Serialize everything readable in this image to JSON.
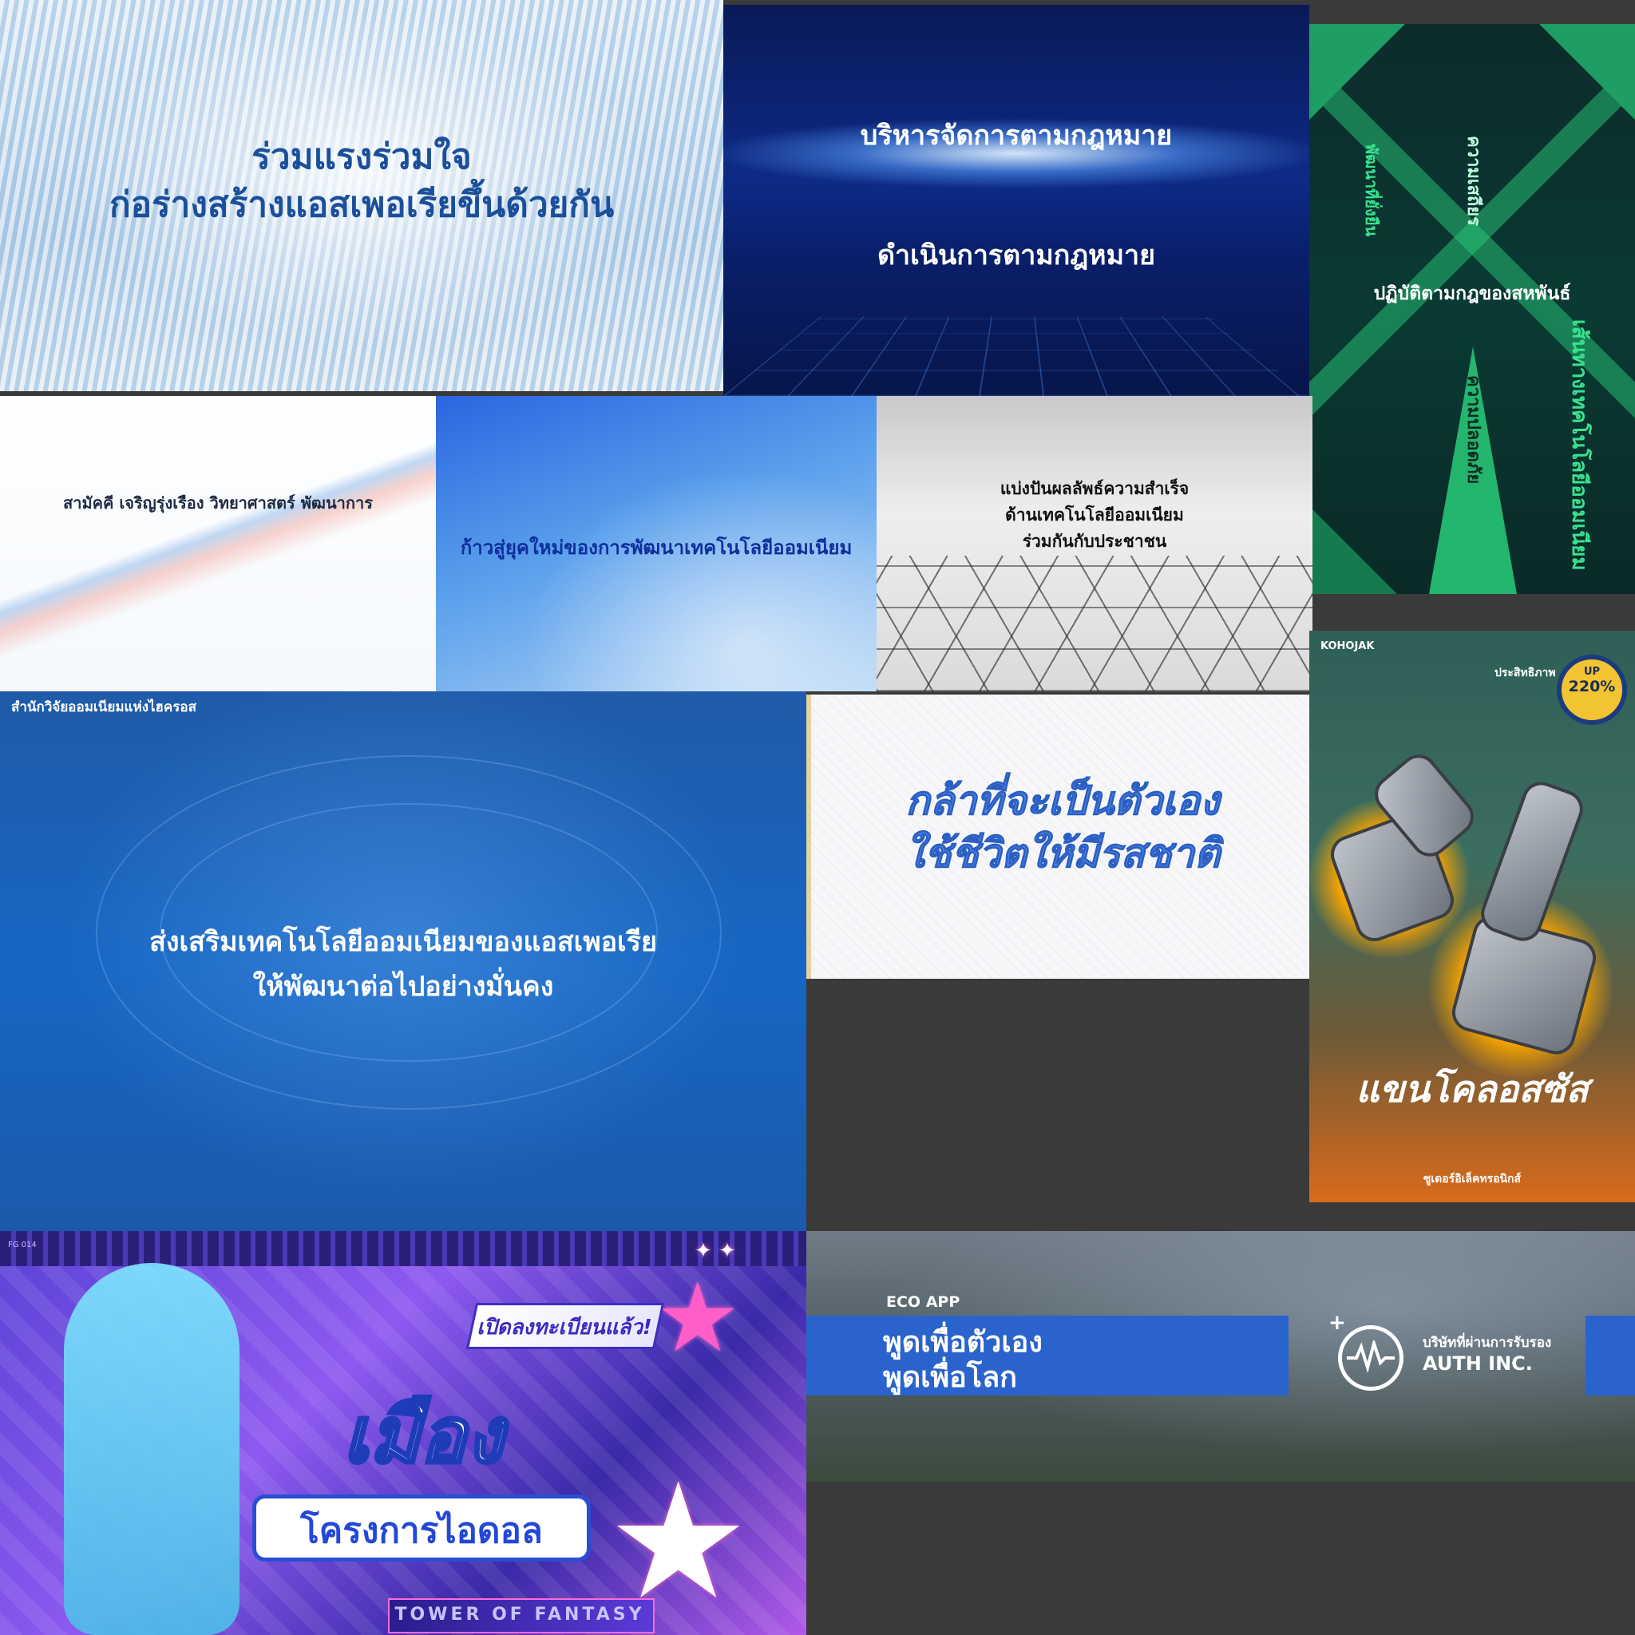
{
  "panel1": {
    "line1": "ร่วมแรงร่วมใจ",
    "line2": "ก่อร่างสร้างแอสเพอเรียขึ้นด้วยกัน"
  },
  "panel2": {
    "line1": "บริหารจัดการตามกฎหมาย",
    "line2": "ดำเนินการตามกฎหมาย"
  },
  "panel3": {
    "center": "ปฏิบัติตามกฎของสหพันธ์",
    "v1": "พัฒนาที่ยั่งยืน",
    "v2": "ความเสถียร",
    "v3": "ความปลอดภัย",
    "v4": "เส้นทางเทคโนโลยีออมเนียม"
  },
  "panel4": {
    "text": "สามัคคี เจริญรุ่งเรือง วิทยาศาสตร์ พัฒนาการ"
  },
  "panel5": {
    "text": "ก้าวสู่ยุคใหม่ของการพัฒนาเทคโนโลยีออมเนียม"
  },
  "panel6": {
    "line1": "แบ่งปันผลลัพธ์ความสำเร็จ",
    "line2": "ด้านเทคโนโลยีออมเนียม",
    "line3": "ร่วมกันกับประชาชน"
  },
  "panel7": {
    "header": "สำนักวิจัยออมเนียมแห่งไฮครอส",
    "line1": "ส่งเสริมเทคโนโลยีออมเนียมของแอสเพอเรีย",
    "line2": "ให้พัฒนาต่อไปอย่างมั่นคง"
  },
  "panel8": {
    "line1": "กล้าที่จะเป็นตัวเอง",
    "line2": "ใช้ชีวิตให้มีรสชาติ"
  },
  "panel9": {
    "brand": "KOHOJAK",
    "label": "ประสิทธิภาพ",
    "badge_top": "UP",
    "badge_value": "220%",
    "title": "แขนโคลอสซัส",
    "footer": "ซูเดอร์อิเล็คทรอนิกส์"
  },
  "panel10": {
    "tag": "เปิดลงทะเบียนแล้ว!",
    "title": "เมือง",
    "subtitle": "โครงการไอดอล",
    "footer": "TOWER OF FANTASY",
    "corner": "FG 014"
  },
  "panel11": {
    "label": "ECO APP",
    "line1": "พูดเพื่อตัวเอง",
    "line2": "พูดเพื่อโลก",
    "company_label": "บริษัทที่ผ่านการรับรอง",
    "company_name": "AUTH INC."
  }
}
